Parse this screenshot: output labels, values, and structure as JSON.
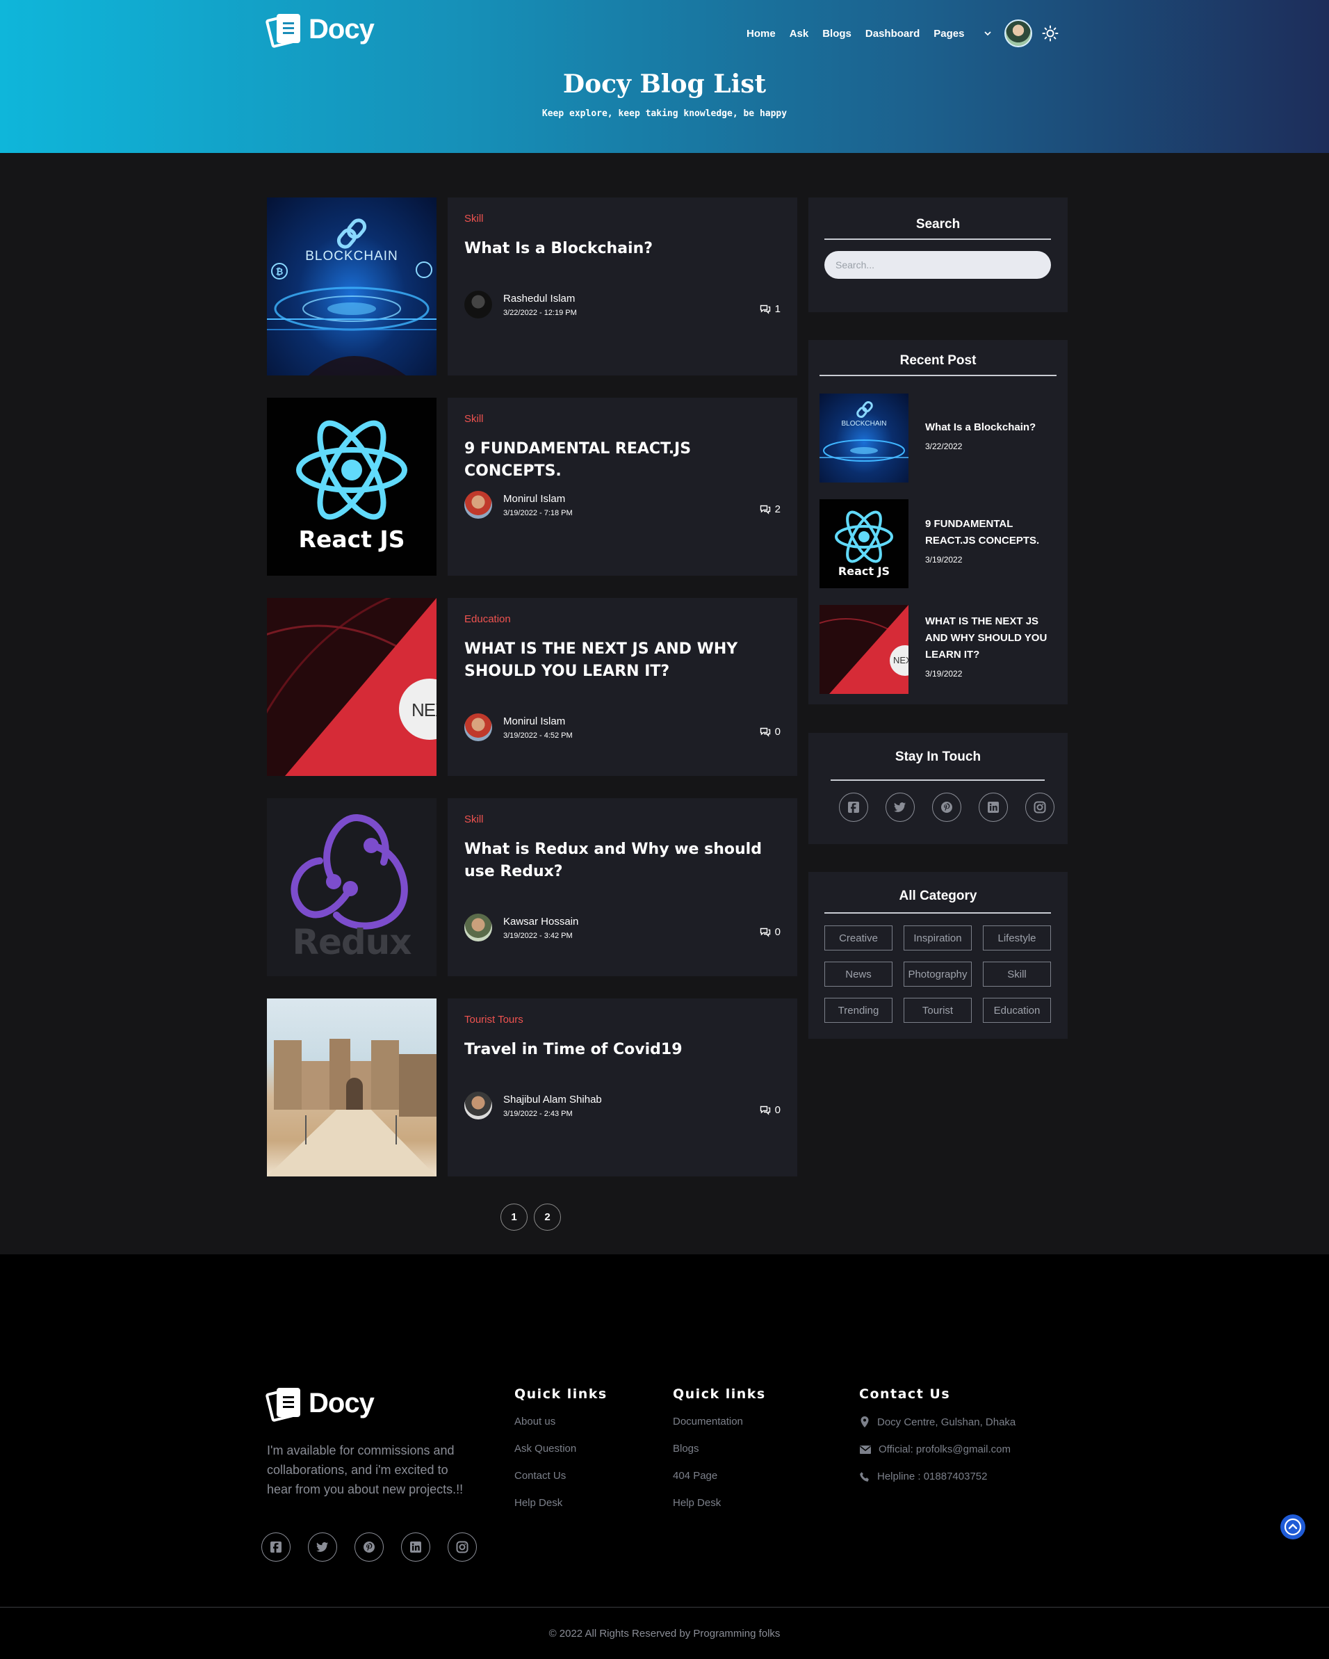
{
  "brand": {
    "name": "Docy"
  },
  "nav": {
    "items": [
      "Home",
      "Ask",
      "Blogs",
      "Dashboard",
      "Pages"
    ]
  },
  "hero": {
    "title": "Docy Blog List",
    "subtitle": "Keep explore, keep taking knowledge, be happy"
  },
  "posts": [
    {
      "category": "Skill",
      "title": "What Is a Blockchain?",
      "author": "Rashedul Islam",
      "date": "3/22/2022 - 12:19 PM",
      "comments": "1",
      "thumb_text": "BLOCKCHAIN"
    },
    {
      "category": "Skill",
      "title": "9 FUNDAMENTAL REACT.JS CONCEPTS.",
      "author": "Monirul Islam",
      "date": "3/19/2022 - 7:18 PM",
      "comments": "2",
      "thumb_text": "React JS"
    },
    {
      "category": "Education",
      "title": "WHAT IS THE NEXT JS AND WHY SHOULD YOU LEARN IT?",
      "author": "Monirul Islam",
      "date": "3/19/2022 - 4:52 PM",
      "comments": "0",
      "thumb_text": "NEX"
    },
    {
      "category": "Skill",
      "title": "What is Redux and Why we should use Redux?",
      "author": "Kawsar Hossain",
      "date": "3/19/2022 - 3:42 PM",
      "comments": "0",
      "thumb_text": "Redux"
    },
    {
      "category": "Tourist Tours",
      "title": "Travel in Time of Covid19",
      "author": "Shajibul Alam Shihab",
      "date": "3/19/2022 - 2:43 PM",
      "comments": "0"
    }
  ],
  "pagination": {
    "pages": [
      "1",
      "2"
    ]
  },
  "sidebar": {
    "search": {
      "title": "Search",
      "placeholder": "Search..."
    },
    "recent": {
      "title": "Recent Post",
      "items": [
        {
          "title": "What Is a Blockchain?",
          "date": "3/22/2022",
          "thumb_text": "BLOCKCHAIN"
        },
        {
          "title": "9 FUNDAMENTAL REACT.JS CONCEPTS.",
          "date": "3/19/2022",
          "thumb_text": "React JS"
        },
        {
          "title": "WHAT IS THE NEXT JS AND WHY SHOULD YOU LEARN IT?",
          "date": "3/19/2022",
          "thumb_text": "NEX"
        }
      ]
    },
    "touch": {
      "title": "Stay In Touch",
      "icons": [
        "facebook-icon",
        "twitter-icon",
        "pinterest-icon",
        "linkedin-icon",
        "instagram-icon"
      ]
    },
    "categories": {
      "title": "All Category",
      "items": [
        "Creative",
        "Inspiration",
        "Lifestyle",
        "News",
        "Photography",
        "Skill",
        "Trending",
        "Tourist",
        "Education"
      ]
    }
  },
  "footer": {
    "about": "I'm available for commissions and collaborations, and i'm excited to hear from you about new projects.!!",
    "col1": {
      "title": "Quick links",
      "links": [
        "About us",
        "Ask Question",
        "Contact Us",
        "Help Desk"
      ]
    },
    "col2": {
      "title": "Quick links",
      "links": [
        "Documentation",
        "Blogs",
        "404 Page",
        "Help Desk"
      ]
    },
    "contact": {
      "title": "Contact Us",
      "address": "Docy Centre, Gulshan, Dhaka",
      "email": "Official: profolks@gmail.com",
      "phone": "Helpline : 01887403752"
    },
    "copyright": "© 2022 All Rights Reserved by Programming folks"
  },
  "colors": {
    "accent_red": "#ef5350",
    "card_bg": "#1d1e25",
    "page_bg": "#151517",
    "footer_bg": "#000000"
  }
}
